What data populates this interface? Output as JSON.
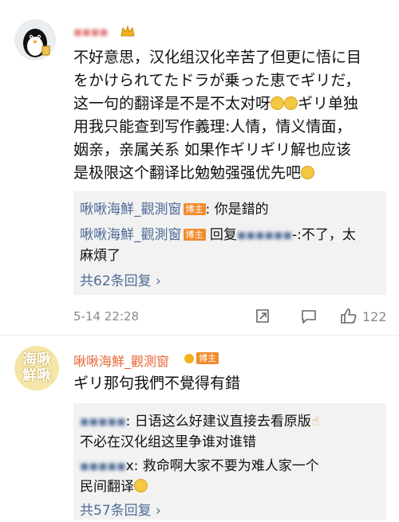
{
  "comment1": {
    "username": "▪▪▪▪",
    "lines": [
      "不好意思，汉化组汉化辛苦了但更に悟に目",
      "をかけられてたドラが乗った恵でギリだ，",
      "这一句的翻译是不是不太对呀",
      "ギリ单独",
      "用我只能查到写作義理:人情，情义情面，",
      "姻亲，亲属关系 如果作ギリギリ解也应该",
      "是极限这个翻译比勉勉强强优先吧"
    ],
    "replies": {
      "r1_user": "啾啾海鮮_觀測窗",
      "r1_badge": "博主",
      "r1_text": ": 你是錯的",
      "r2_user": "啾啾海鮮_觀測窗",
      "r2_badge": "博主",
      "r2_prefix": " 回复",
      "r2_blurred": "▪▪▪▪▪▪",
      "r2_text": "-:不了，太",
      "r2_text2": "麻煩了",
      "more": "共62条回复 ›"
    },
    "time": "5-14 22:28",
    "likes": "122"
  },
  "comment2": {
    "username": "啾啾海鮮_觀測窗",
    "badge": "博主",
    "avatar_text": "海啾鮮啾",
    "text": "ギリ那句我們不覺得有錯",
    "replies": {
      "r1_blurred": "▪▪▪▪▪",
      "r1_text": ": 日语这么好建议直接去看原版",
      "r1_text2": "不必在汉化组这里争谁对谁错",
      "r2_blurred": "▪▪▪▪▪",
      "r2_text": "x: 救命啊大家不要为难人家一个",
      "r2_text2": "民间翻译",
      "more": "共57条回复 ›"
    }
  },
  "colors": {
    "link": "#4f6c97",
    "badge": "#f08c2c",
    "gray": "#8a8a8a"
  }
}
